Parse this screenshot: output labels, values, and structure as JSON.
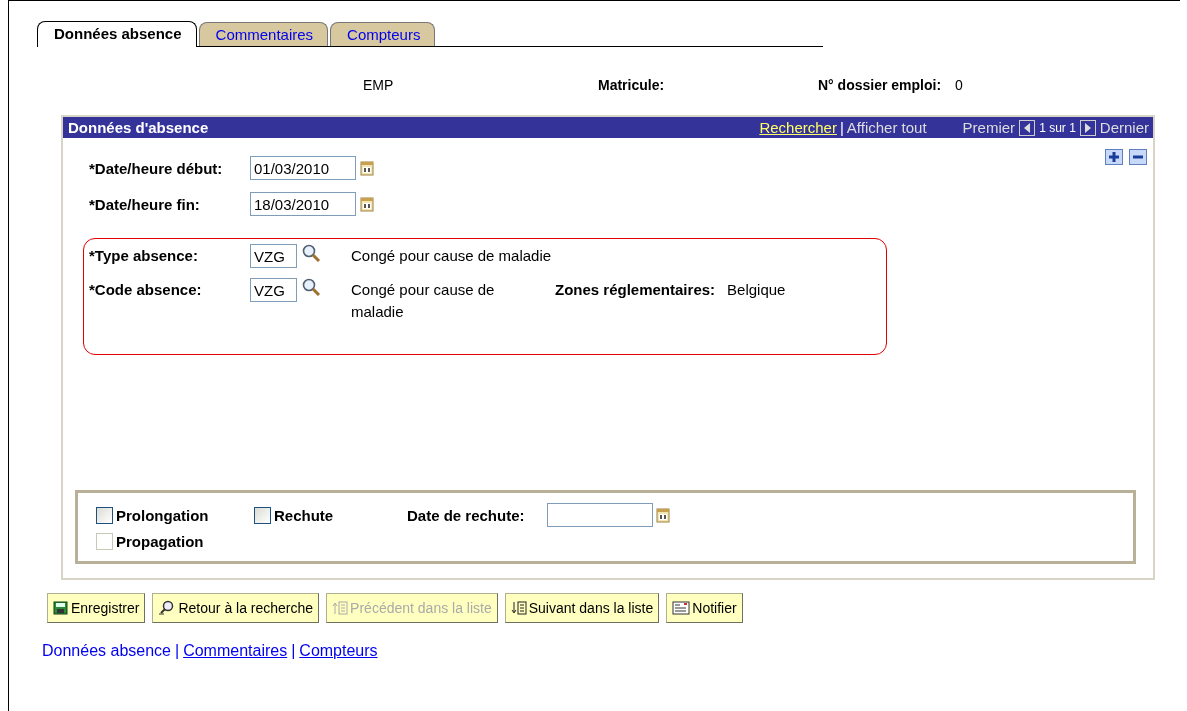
{
  "tabs": [
    {
      "label": "Données absence",
      "selected": true
    },
    {
      "label": "Commentaires",
      "selected": false
    },
    {
      "label": "Compteurs",
      "selected": false
    }
  ],
  "header": {
    "employee": "EMP",
    "matricule_label": "Matricule:",
    "dossier_label": "N° dossier emploi:",
    "dossier_value": "0"
  },
  "panel": {
    "title": "Données d'absence",
    "search_link": "Rechercher",
    "separator": "|",
    "show_all": "Afficher tout",
    "first": "Premier",
    "count": "1 sur 1",
    "last": "Dernier"
  },
  "dates": [
    {
      "label": "*Date/heure début:",
      "value": "01/03/2010"
    },
    {
      "label": "*Date/heure fin:",
      "value": "18/03/2010"
    }
  ],
  "absence": [
    {
      "label": "*Type absence:",
      "value": "VZG",
      "description": "Congé pour cause de maladie"
    },
    {
      "label": "*Code absence:",
      "value": "VZG",
      "description": "Congé pour cause de maladie",
      "zone_label": "Zones réglementaires:",
      "zone_value": "Belgique"
    }
  ],
  "options": {
    "checkboxes": [
      {
        "label": "Prolongation",
        "checked": false,
        "disabled": false
      },
      {
        "label": "Rechute",
        "checked": false,
        "disabled": false
      },
      {
        "label": "Propagation",
        "checked": false,
        "disabled": true
      }
    ],
    "relapse_date_label": "Date de rechute:"
  },
  "buttons": [
    {
      "label": "Enregistrer",
      "kind": "save",
      "disabled": false
    },
    {
      "label": "Retour à la recherche",
      "kind": "search",
      "disabled": false
    },
    {
      "label": "Précédent dans la liste",
      "kind": "up",
      "disabled": true
    },
    {
      "label": "Suivant dans la liste",
      "kind": "down",
      "disabled": false
    },
    {
      "label": "Notifier",
      "kind": "notify",
      "disabled": false
    }
  ],
  "bottom_links": {
    "separator": "|",
    "links": [
      {
        "label": "Données absence",
        "selected": true
      },
      {
        "label": "Commentaires",
        "selected": false
      },
      {
        "label": "Compteurs",
        "selected": false
      }
    ]
  }
}
